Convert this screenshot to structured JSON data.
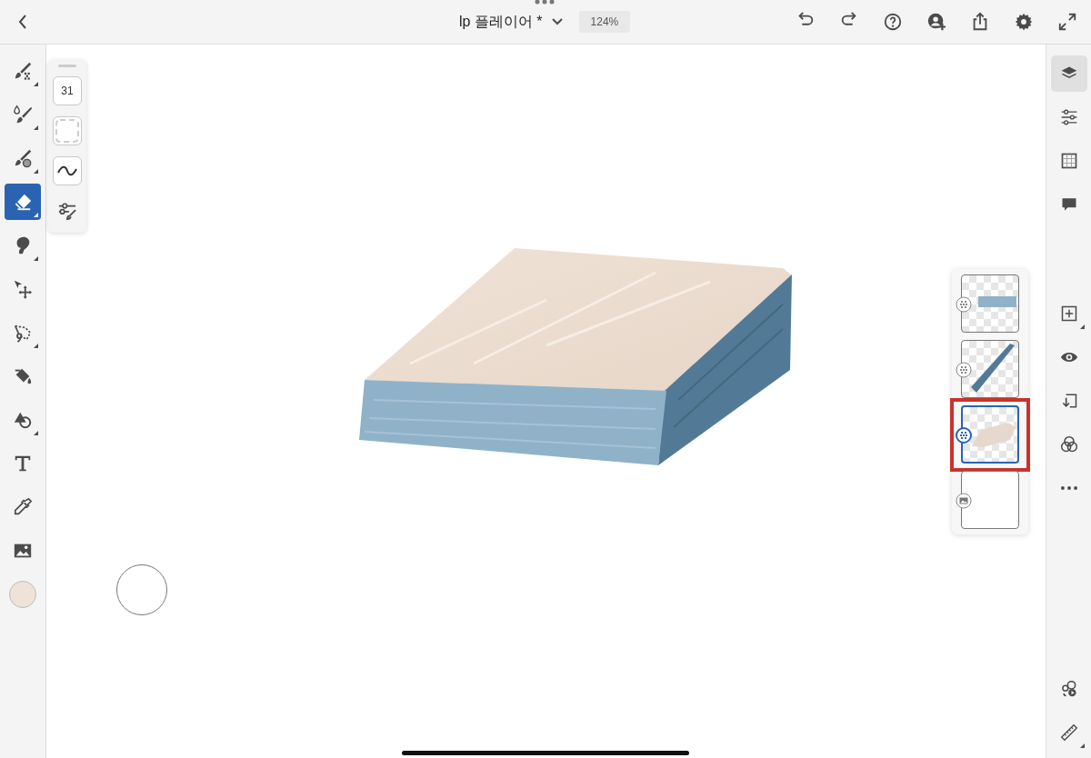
{
  "document": {
    "title": "lp 플레이어 *",
    "zoom": "124%"
  },
  "tools": [
    {
      "selected": false,
      "flyout": true
    },
    {
      "selected": false,
      "flyout": true
    },
    {
      "selected": false,
      "flyout": true
    },
    {
      "selected": true,
      "flyout": true
    },
    {
      "selected": false,
      "flyout": true
    },
    {
      "selected": false,
      "flyout": false
    },
    {
      "selected": false,
      "flyout": true
    },
    {
      "selected": false,
      "flyout": false
    },
    {
      "selected": false,
      "flyout": true
    },
    {
      "selected": false,
      "flyout": false
    },
    {
      "selected": false,
      "flyout": false
    },
    {
      "selected": false,
      "flyout": false
    }
  ],
  "color_swatch": {
    "color": "#efe3d8"
  },
  "brush_panel": {
    "size": "31"
  },
  "layers": [
    {
      "kind": "pixel",
      "selected": false
    },
    {
      "kind": "pixel",
      "selected": false
    },
    {
      "kind": "pixel",
      "selected": true
    },
    {
      "kind": "image",
      "selected": false
    }
  ],
  "right_tools": [
    {
      "selected": true,
      "flyout": false
    },
    {
      "selected": false,
      "flyout": false
    },
    {
      "selected": false,
      "flyout": false
    },
    {
      "selected": false,
      "flyout": false
    },
    {
      "selected": false,
      "flyout": true
    },
    {
      "selected": false,
      "flyout": false
    },
    {
      "selected": false,
      "flyout": false
    },
    {
      "selected": false,
      "flyout": false
    },
    {
      "selected": false,
      "flyout": false
    }
  ],
  "right_bottom_tools": [
    {
      "selected": false,
      "flyout": false
    },
    {
      "selected": false,
      "flyout": true
    }
  ]
}
